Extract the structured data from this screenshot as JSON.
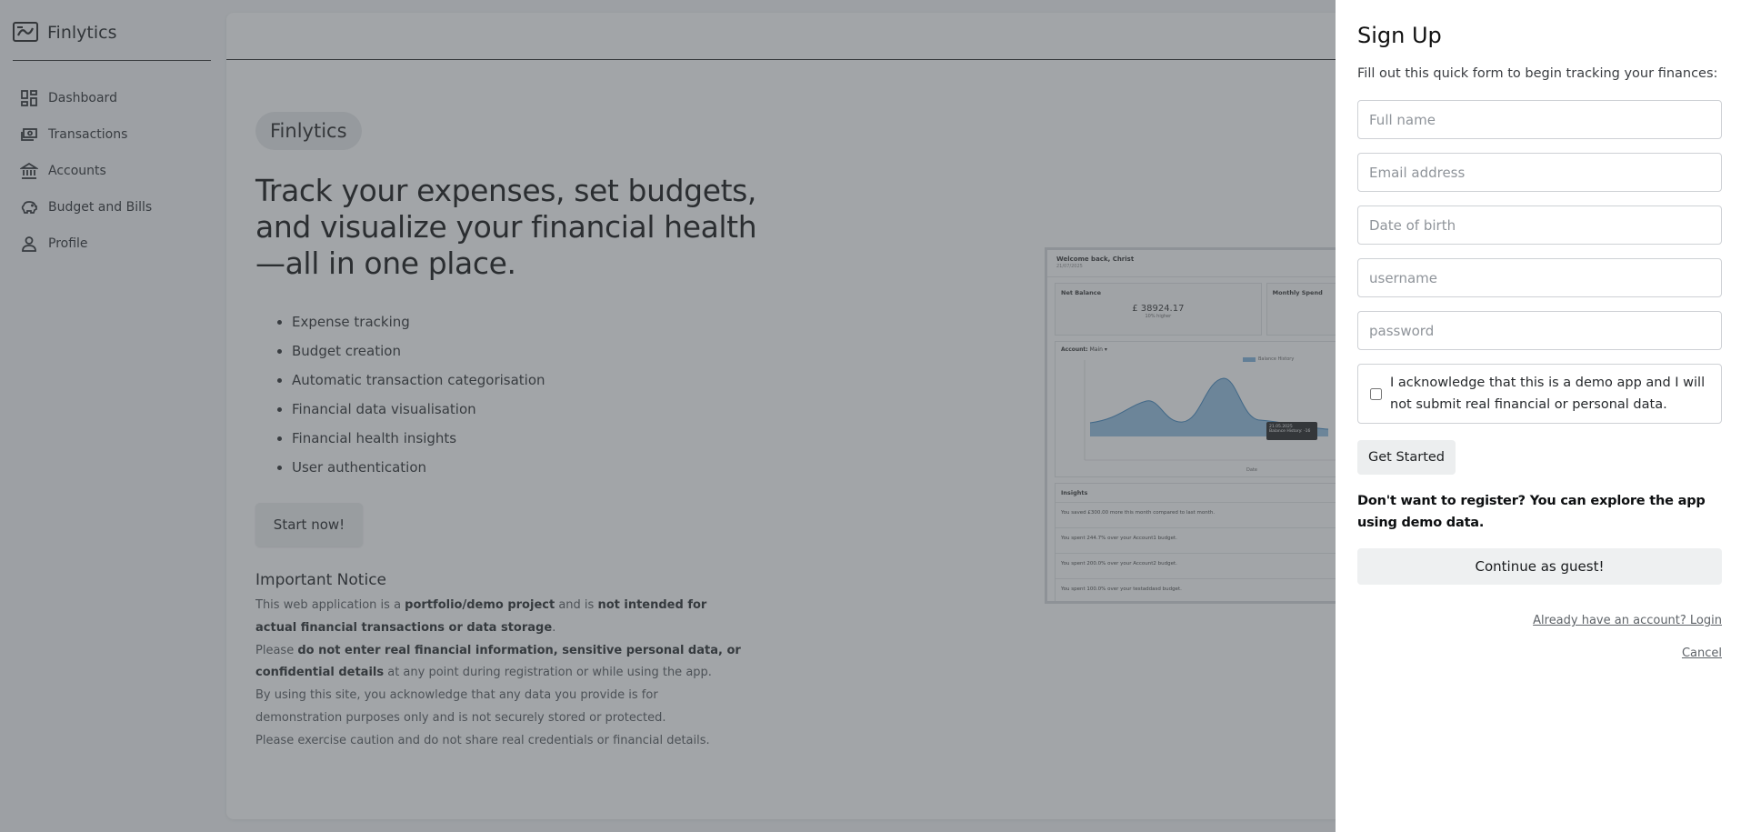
{
  "sidebar": {
    "brand": "Finlytics",
    "items": [
      {
        "label": "Dashboard",
        "icon": "dashboard-icon"
      },
      {
        "label": "Transactions",
        "icon": "money-icon"
      },
      {
        "label": "Accounts",
        "icon": "bank-icon"
      },
      {
        "label": "Budget and Bills",
        "icon": "piggy-bank-icon"
      },
      {
        "label": "Profile",
        "icon": "user-icon"
      }
    ]
  },
  "hero": {
    "badge": "Finlytics",
    "title": "Track your expenses, set budgets, and visualize your financial health—all in one place.",
    "features": [
      "Expense tracking",
      "Budget creation",
      "Automatic transaction categorisation",
      "Financial data visualisation",
      "Financial health insights",
      "User authentication"
    ],
    "cta": "Start now!"
  },
  "notice": {
    "title": "Important Notice",
    "p1_a": "This web application is a ",
    "p1_b": "portfolio/demo project",
    "p1_c": " and is ",
    "p1_d": "not intended for actual financial transactions or data storage",
    "p1_e": ".",
    "p2_a": "Please ",
    "p2_b": "do not enter real financial information, sensitive personal data, or confidential details",
    "p2_c": " at any point during registration or while using the app.",
    "p3": "By using this site, you acknowledge that any data you provide is for demonstration purposes only and is not securely stored or protected.",
    "p4": "Please exercise caution and do not share real credentials or financial details."
  },
  "preview": {
    "welcome": "Welcome back, Christ",
    "date": "21/07/2025",
    "net_balance_label": "Net Balance",
    "net_balance_value": "£ 38924.17",
    "net_balance_pct": "10% higher",
    "monthly_spend_label": "Monthly Spend",
    "account_label": "Account:",
    "account_value": "Main",
    "legend": "Balance History",
    "tooltip_date": "21.05.2025",
    "tooltip_value": "Balance History: -16",
    "xlabel": "Date",
    "insights_title": "Insights",
    "insights": [
      "You saved £300.00 more this month compared to last month.",
      "You spent 244.7% over your Account1 budget.",
      "You spent 200.0% over your Account2 budget.",
      "You spent 100.0% over your testaddasd budget."
    ]
  },
  "signup": {
    "title": "Sign Up",
    "subtitle": "Fill out this quick form to begin tracking your finances:",
    "fields": {
      "full_name": "Full name",
      "email": "Email address",
      "dob": "Date of birth",
      "username": "username",
      "password": "password"
    },
    "acknowledge": "I acknowledge that this is a demo app and  I will not submit real financial or personal data.",
    "acknowledge_checked": false,
    "get_started": "Get Started",
    "guest_note": "Don't want to register? You can explore the app using demo data.",
    "guest_button": "Continue as guest!",
    "login_link": "Already have an account?  Login",
    "cancel_link": "Cancel"
  },
  "colors": {
    "overlay": "#464b52",
    "chart_fill": "#7fb3dc",
    "chart_line": "#3d84bd"
  }
}
